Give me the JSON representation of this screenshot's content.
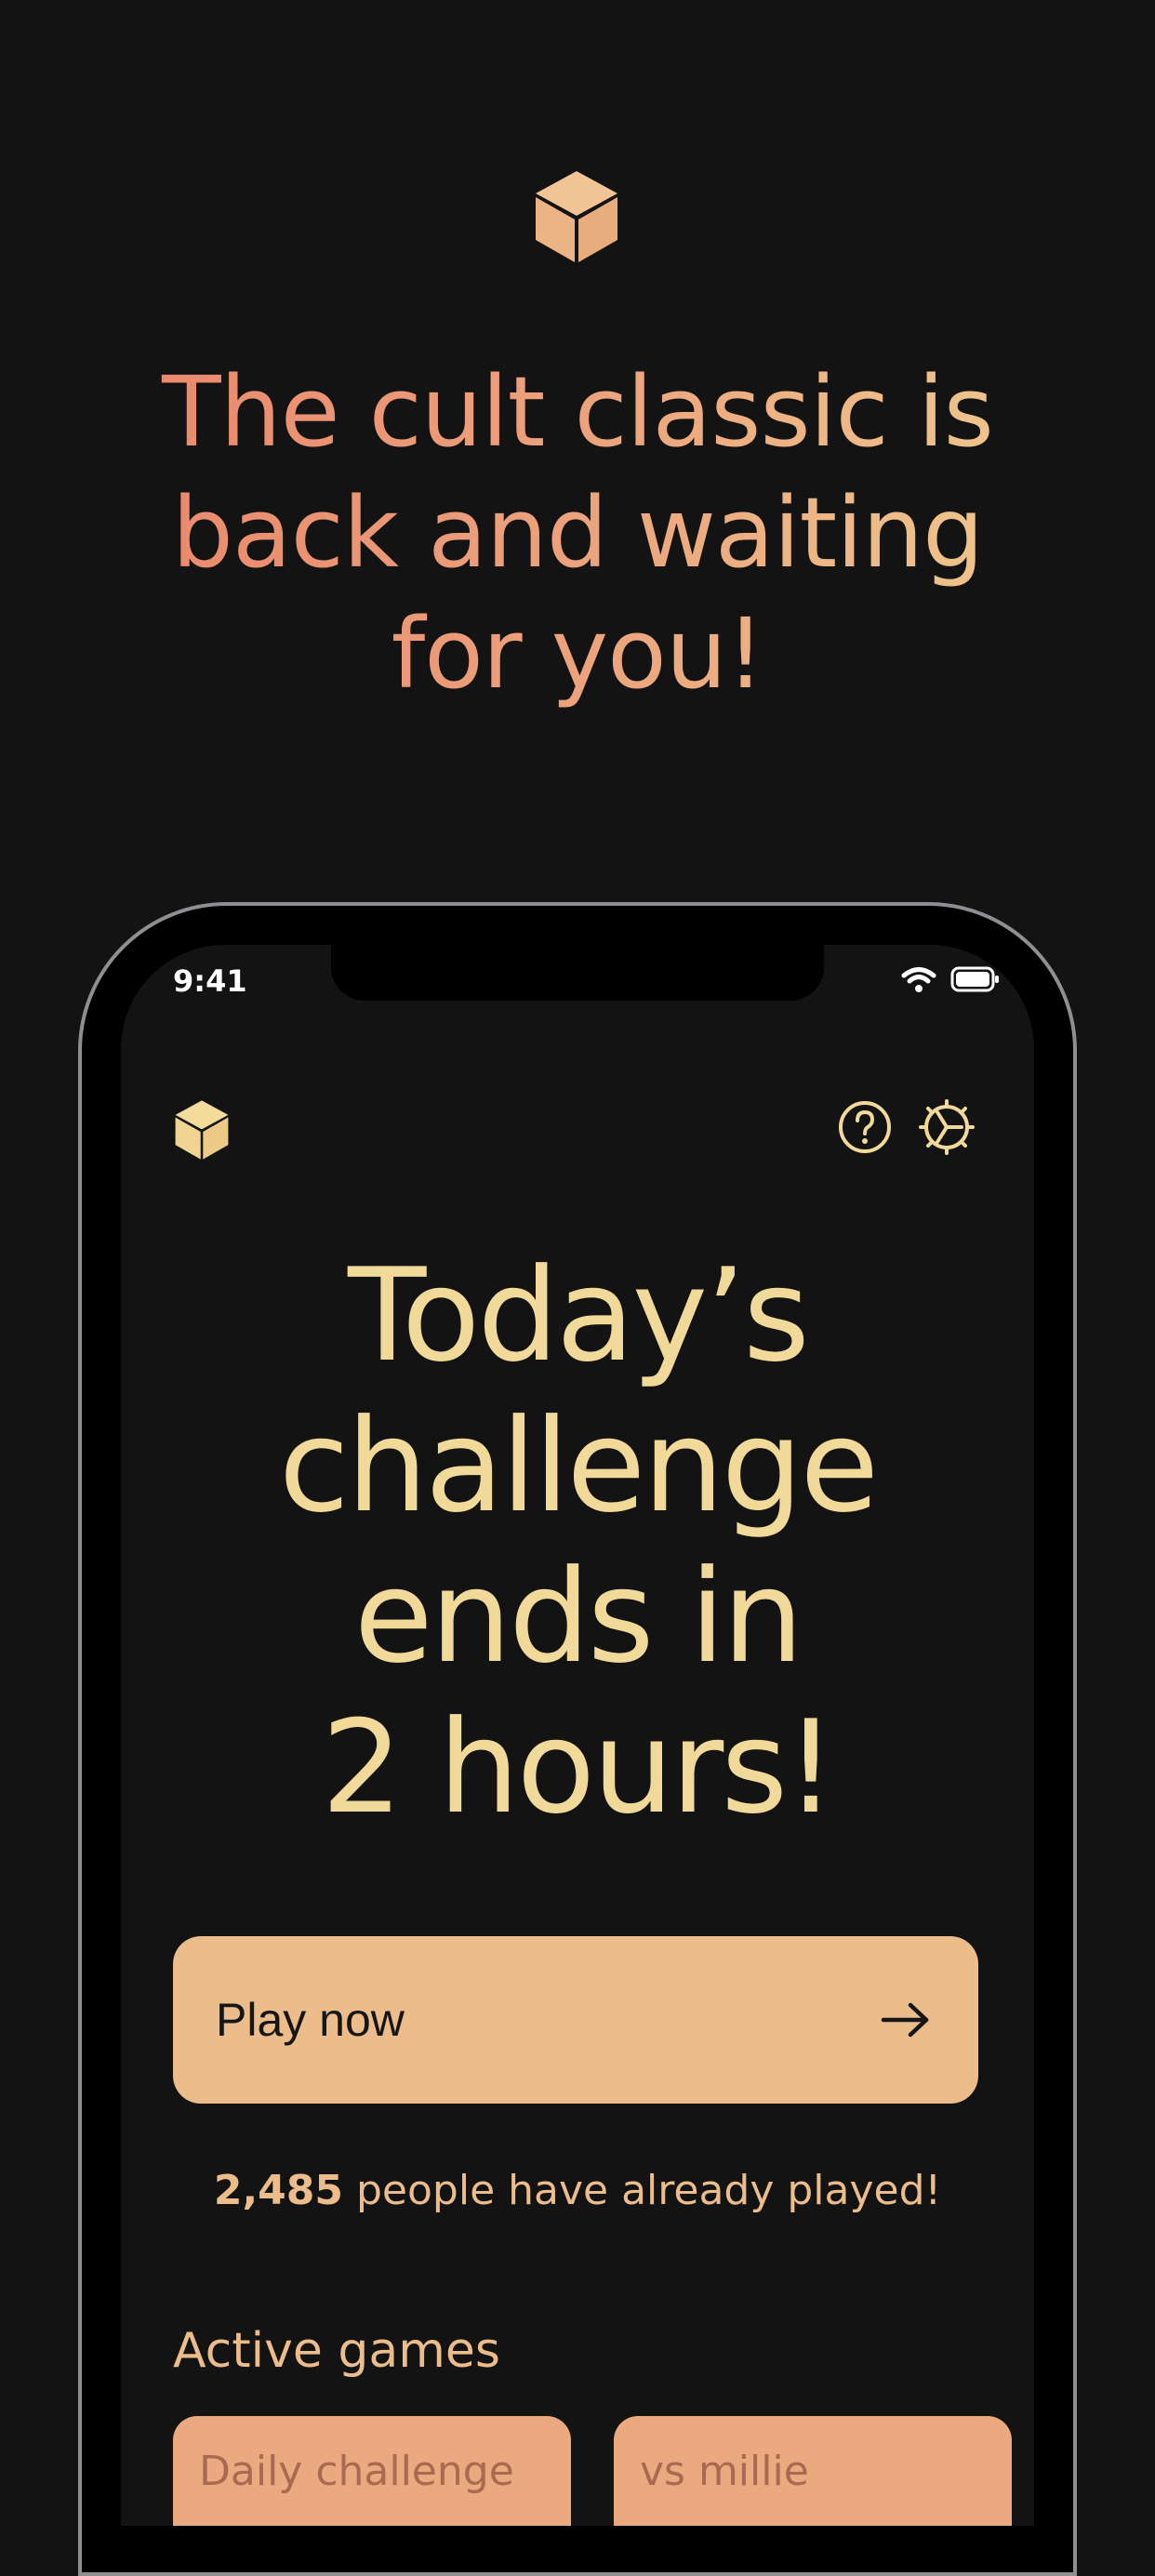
{
  "promo": {
    "headline": "The cult classic is back and waiting for you!"
  },
  "status_bar": {
    "time": "9:41",
    "icons": [
      "wifi-icon",
      "battery-icon"
    ]
  },
  "header": {
    "icons": [
      "cube-logo-icon",
      "help-icon",
      "gear-icon"
    ]
  },
  "challenge": {
    "title_lines": [
      "Today’s",
      "challenge",
      "ends in",
      "2 hours!"
    ]
  },
  "play_button": {
    "label": "Play now",
    "icon": "arrow-right-icon"
  },
  "stats": {
    "count": "2,485",
    "suffix": " people have already played!"
  },
  "active_games": {
    "title": "Active games",
    "games": [
      {
        "label": "Daily challenge"
      },
      {
        "label": "vs millie"
      }
    ]
  },
  "colors": {
    "background": "#131313",
    "accent_peach": "#ecbd8a",
    "accent_yellow": "#f1d99a",
    "headline_gradient": [
      "#e9866b",
      "#efc98d"
    ],
    "card": "#eba97f"
  }
}
